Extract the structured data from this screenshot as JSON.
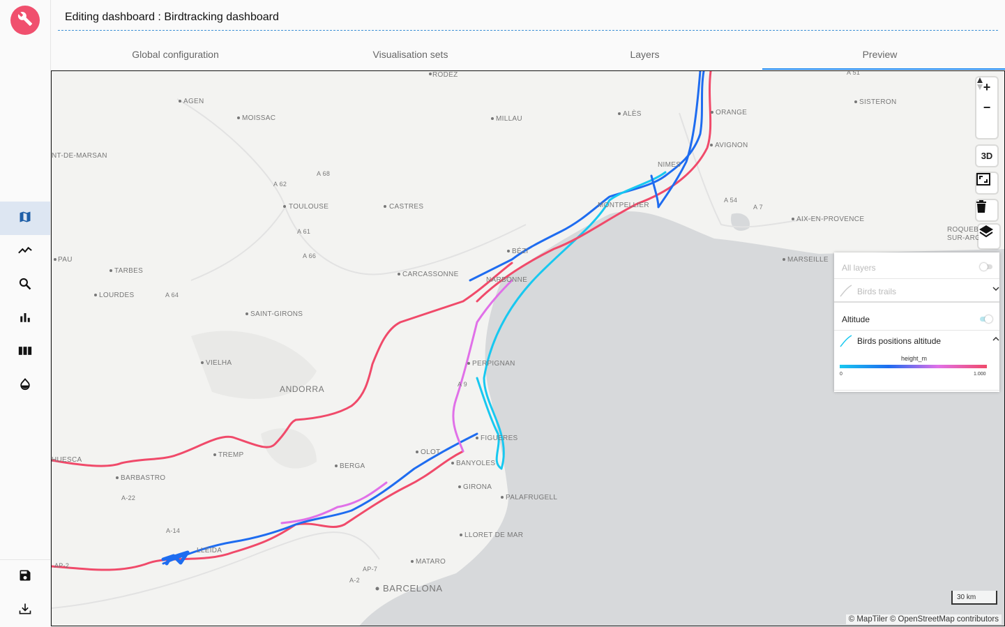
{
  "header": {
    "title": "Editing dashboard : Birdtracking dashboard"
  },
  "tabs": [
    {
      "label": "Global configuration"
    },
    {
      "label": "Visualisation sets"
    },
    {
      "label": "Layers"
    },
    {
      "label": "Preview"
    }
  ],
  "active_tab": "Preview",
  "sidebar": {
    "logo_icon": "wrench-icon",
    "items": [
      {
        "icon": "map-icon",
        "active": true
      },
      {
        "icon": "line-chart-icon",
        "active": false
      },
      {
        "icon": "search-icon",
        "active": false
      },
      {
        "icon": "bar-chart-icon",
        "active": false
      },
      {
        "icon": "columns-icon",
        "active": false
      },
      {
        "icon": "drop-icon",
        "active": false
      }
    ],
    "bottom": [
      {
        "icon": "save-icon"
      },
      {
        "icon": "download-icon"
      }
    ]
  },
  "map": {
    "controls": {
      "zoom_in": "+",
      "zoom_out": "−",
      "three_d": "3D"
    },
    "scale_label": "30 km",
    "attribution": "© MapTiler © OpenStreetMap contributors",
    "places": [
      "RODEZ",
      "AGEN",
      "MOISSAC",
      "MILLAU",
      "ALÈS",
      "ORANGE",
      "SISTERON",
      "AVIGNON",
      "NIMES",
      "NT-DE-MARSAN",
      "TOULOUSE",
      "CASTRES",
      "MONTPELLIER",
      "AIX-EN-PROVENCE",
      "MARSEILLE",
      "ROQUEBR",
      "SUR-ARG",
      "BÉZI",
      "PAU",
      "TARBES",
      "CARCASSONNE",
      "NARBONNE",
      "LOURDES",
      "SAINT-GIRONS",
      "VIELHA",
      "ANDORRA",
      "PERPIGNAN",
      "FIGUERES",
      "HUESCA",
      "TREMP",
      "OLOT",
      "BANYOLES",
      "BERGA",
      "BARBASTRO",
      "GIRONA",
      "PALAFRUGELL",
      "LLORET DE MAR",
      "MATARO",
      "BARCELONA",
      "LLEIDA"
    ],
    "roads": [
      "A 68",
      "A 62",
      "A 61",
      "A 66",
      "A 64",
      "A 9",
      "A 54",
      "A 7",
      "A 51",
      "A-22",
      "A-14",
      "AP-2",
      "AP-7",
      "A-2"
    ]
  },
  "layers_panel": {
    "all_layers_label": "All layers",
    "groups": [
      {
        "label": "Birds trails",
        "enabled": false,
        "expanded": false
      },
      {
        "label": "Altitude",
        "enabled": true,
        "layers": [
          {
            "label": "Birds positions altitude",
            "expanded": true,
            "legend": {
              "field": "height_m",
              "min": "0",
              "max": "1.000",
              "gradient": [
                "#18c8f0",
                "#1e6cf0",
                "#e070e8",
                "#f04a6a"
              ]
            }
          }
        ]
      }
    ]
  },
  "colors": {
    "accent": "#1e87f0",
    "logo": "#f0506e",
    "track_low": "#18c8f0",
    "track_mid": "#1e6cf0",
    "track_high": "#f04a6a"
  }
}
